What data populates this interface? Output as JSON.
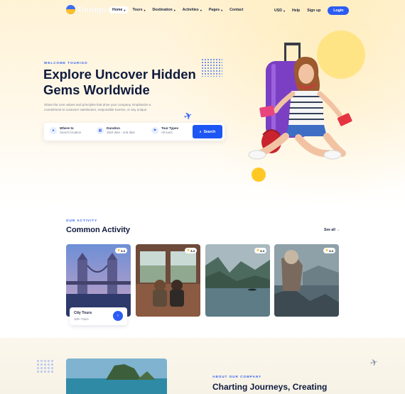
{
  "nav": {
    "logo": "Tourigo",
    "items": [
      {
        "label": "Home",
        "active": true
      },
      {
        "label": "Tours"
      },
      {
        "label": "Destination"
      },
      {
        "label": "Activities"
      },
      {
        "label": "Pages"
      },
      {
        "label": "Contact"
      }
    ],
    "currency": "USD",
    "help": "Help",
    "signup": "Sign up",
    "login": "Login"
  },
  "hero": {
    "eyebrow": "WELCOME TOURIGO",
    "title": "Explore Uncover Hidden Gems Worldwide",
    "description": "Share the core values and principles that drive your company. Emphasize a commitment to customer satisfaction, responsible tourism, or any unique",
    "search": {
      "where_label": "Where to",
      "where_value": "Search location",
      "duration_label": "Duration",
      "duration_value": "Start date - end date",
      "types_label": "Tour Types",
      "types_value": "All tours",
      "button": "Search"
    }
  },
  "activity": {
    "eyebrow": "OUR ACTIVITY",
    "title": "Common Activity",
    "see_all": "See all",
    "cards": [
      {
        "rating": "4.4",
        "title": "City Tours",
        "subtitle": "100+ Tours"
      },
      {
        "rating": "4.4"
      },
      {
        "rating": "4.4"
      },
      {
        "rating": "4.4"
      }
    ]
  },
  "about": {
    "eyebrow": "ABOUT OUR COMPANY",
    "title": "Charting Journeys, Creating Memories On Site"
  },
  "colors": {
    "accent": "#2b5cf5",
    "dark": "#0f1a3d",
    "yellow": "#ffc824"
  }
}
